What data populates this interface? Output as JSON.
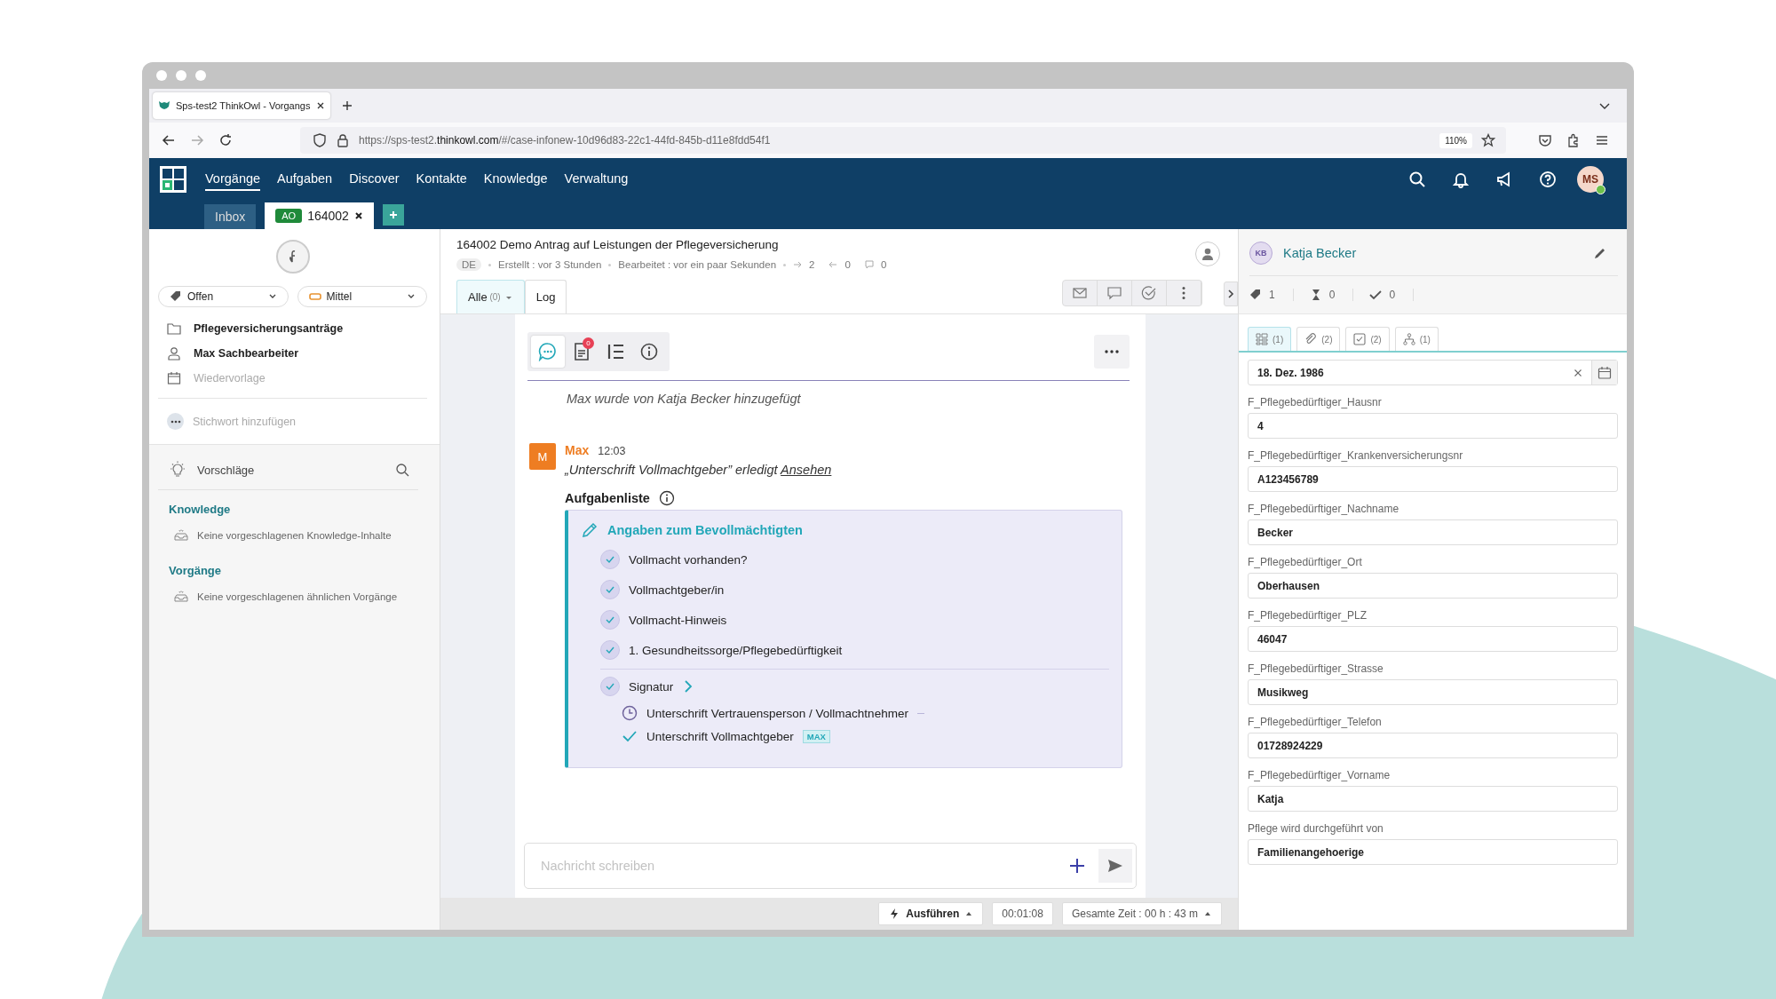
{
  "browser": {
    "tab_title": "Sps-test2 ThinkOwl - Vorgangs",
    "url_start": "https://sps-test2.",
    "url_domain": "thinkowl.com",
    "url_rest": "/#/case-infonew-10d96d83-22c1-44fd-845b-d11e8fdd54f1",
    "zoom": "110%"
  },
  "nav": {
    "items": [
      {
        "label": "Vorgänge",
        "selected": true
      },
      {
        "label": "Aufgaben",
        "selected": false
      },
      {
        "label": "Discover",
        "selected": false
      },
      {
        "label": "Kontakte",
        "selected": false
      },
      {
        "label": "Knowledge",
        "selected": false
      },
      {
        "label": "Verwaltung",
        "selected": false
      }
    ],
    "avatar": "MS",
    "online": true
  },
  "case_tabs": [
    {
      "label": "Inbox",
      "selected": false
    },
    {
      "badge": "AO",
      "label": "164002",
      "selected": true
    }
  ],
  "sidebar": {
    "status": "Offen",
    "priority": "Mittel",
    "info": [
      {
        "kind": "folder",
        "text": "Pflegeversicherungsanträge",
        "empty": false
      },
      {
        "kind": "person",
        "text": "Max Sachbearbeiter",
        "empty": false
      },
      {
        "kind": "calendar",
        "text": "Wiedervorlage",
        "empty": true
      }
    ],
    "keyword_placeholder": "Stichwort hinzufügen",
    "suggestions_title": "Vorschläge",
    "sections": [
      {
        "title": "Knowledge",
        "empty": "Keine vorgeschlagenen Knowledge-Inhalte"
      },
      {
        "title": "Vorgänge",
        "empty": "Keine vorgeschlagenen ähnlichen Vorgänge"
      }
    ]
  },
  "case": {
    "title": "164002 Demo Antrag auf Leistungen der Pflegeversicherung",
    "lang": "DE",
    "created": "Erstellt : vor 3 Stunden",
    "edited": "Bearbeitet : vor ein paar Sekunden",
    "outgoing": "2",
    "incoming": "0",
    "comments": "0",
    "view_tabs": [
      {
        "label": "Alle",
        "count": "(0)",
        "selected": true
      },
      {
        "label": "Log",
        "selected": false
      }
    ]
  },
  "feed": {
    "tools": [
      {
        "kind": "chat",
        "selected": true
      },
      {
        "kind": "document",
        "badge": "0",
        "selected": false
      },
      {
        "kind": "list",
        "selected": false
      },
      {
        "kind": "info",
        "selected": false
      }
    ],
    "system_message": "Max wurde von Katja Becker hinzugefügt",
    "message": {
      "initial": "M",
      "author": "Max",
      "time": "12:03",
      "text": "„Unterschrift Vollmachtgeber” erledigt",
      "link": "Ansehen"
    },
    "tasklist": {
      "title": "Aufgabenliste",
      "group": "Angaben zum Bevollmächtigten",
      "items": [
        {
          "text": "Vollmacht vorhanden?",
          "done": true
        },
        {
          "text": "Vollmachtgeber/in",
          "done": true
        },
        {
          "text": "Vollmacht-Hinweis",
          "done": true
        },
        {
          "text": "1. Gesundheitssorge/Pflegebedürftigkeit",
          "done": true
        },
        {
          "text": "Signatur",
          "done": true,
          "children": [
            {
              "text": "Unterschrift Vertrauensperson / Vollmachtnehmer",
              "done": false
            },
            {
              "text": "Unterschrift Vollmachtgeber",
              "done": true,
              "tag": "MAX"
            }
          ]
        }
      ]
    },
    "composer_placeholder": "Nachricht schreiben"
  },
  "footer": {
    "run": "Ausführen",
    "timer": "00:01:08",
    "total": "Gesamte Zeit : 00 h : 43 m"
  },
  "contact": {
    "initials": "KB",
    "name": "Katja Becker",
    "counters": [
      {
        "kind": "ticket",
        "value": "1"
      },
      {
        "kind": "hourglass",
        "value": "0"
      },
      {
        "kind": "check",
        "value": "0"
      }
    ],
    "tabs": [
      {
        "kind": "fields",
        "count": "(1)",
        "selected": true
      },
      {
        "kind": "link",
        "count": "(2)",
        "selected": false
      },
      {
        "kind": "task",
        "count": "(2)",
        "selected": false
      },
      {
        "kind": "tree",
        "count": "(1)",
        "selected": false
      }
    ],
    "date_value": "18. Dez. 1986",
    "fields": [
      {
        "label": "F_Pflegebedürftiger_Hausnr",
        "value": "4"
      },
      {
        "label": "F_Pflegebedürftiger_Krankenversicherungsnr",
        "value": "A123456789"
      },
      {
        "label": "F_Pflegebedürftiger_Nachname",
        "value": "Becker"
      },
      {
        "label": "F_Pflegebedürftiger_Ort",
        "value": "Oberhausen"
      },
      {
        "label": "F_Pflegebedürftiger_PLZ",
        "value": "46047"
      },
      {
        "label": "F_Pflegebedürftiger_Strasse",
        "value": "Musikweg"
      },
      {
        "label": "F_Pflegebedürftiger_Telefon",
        "value": "01728924229"
      },
      {
        "label": "F_Pflegebedürftiger_Vorname",
        "value": "Katja"
      },
      {
        "label": "Pflege wird durchgeführt von",
        "value": "Familienangehoerige"
      }
    ]
  }
}
